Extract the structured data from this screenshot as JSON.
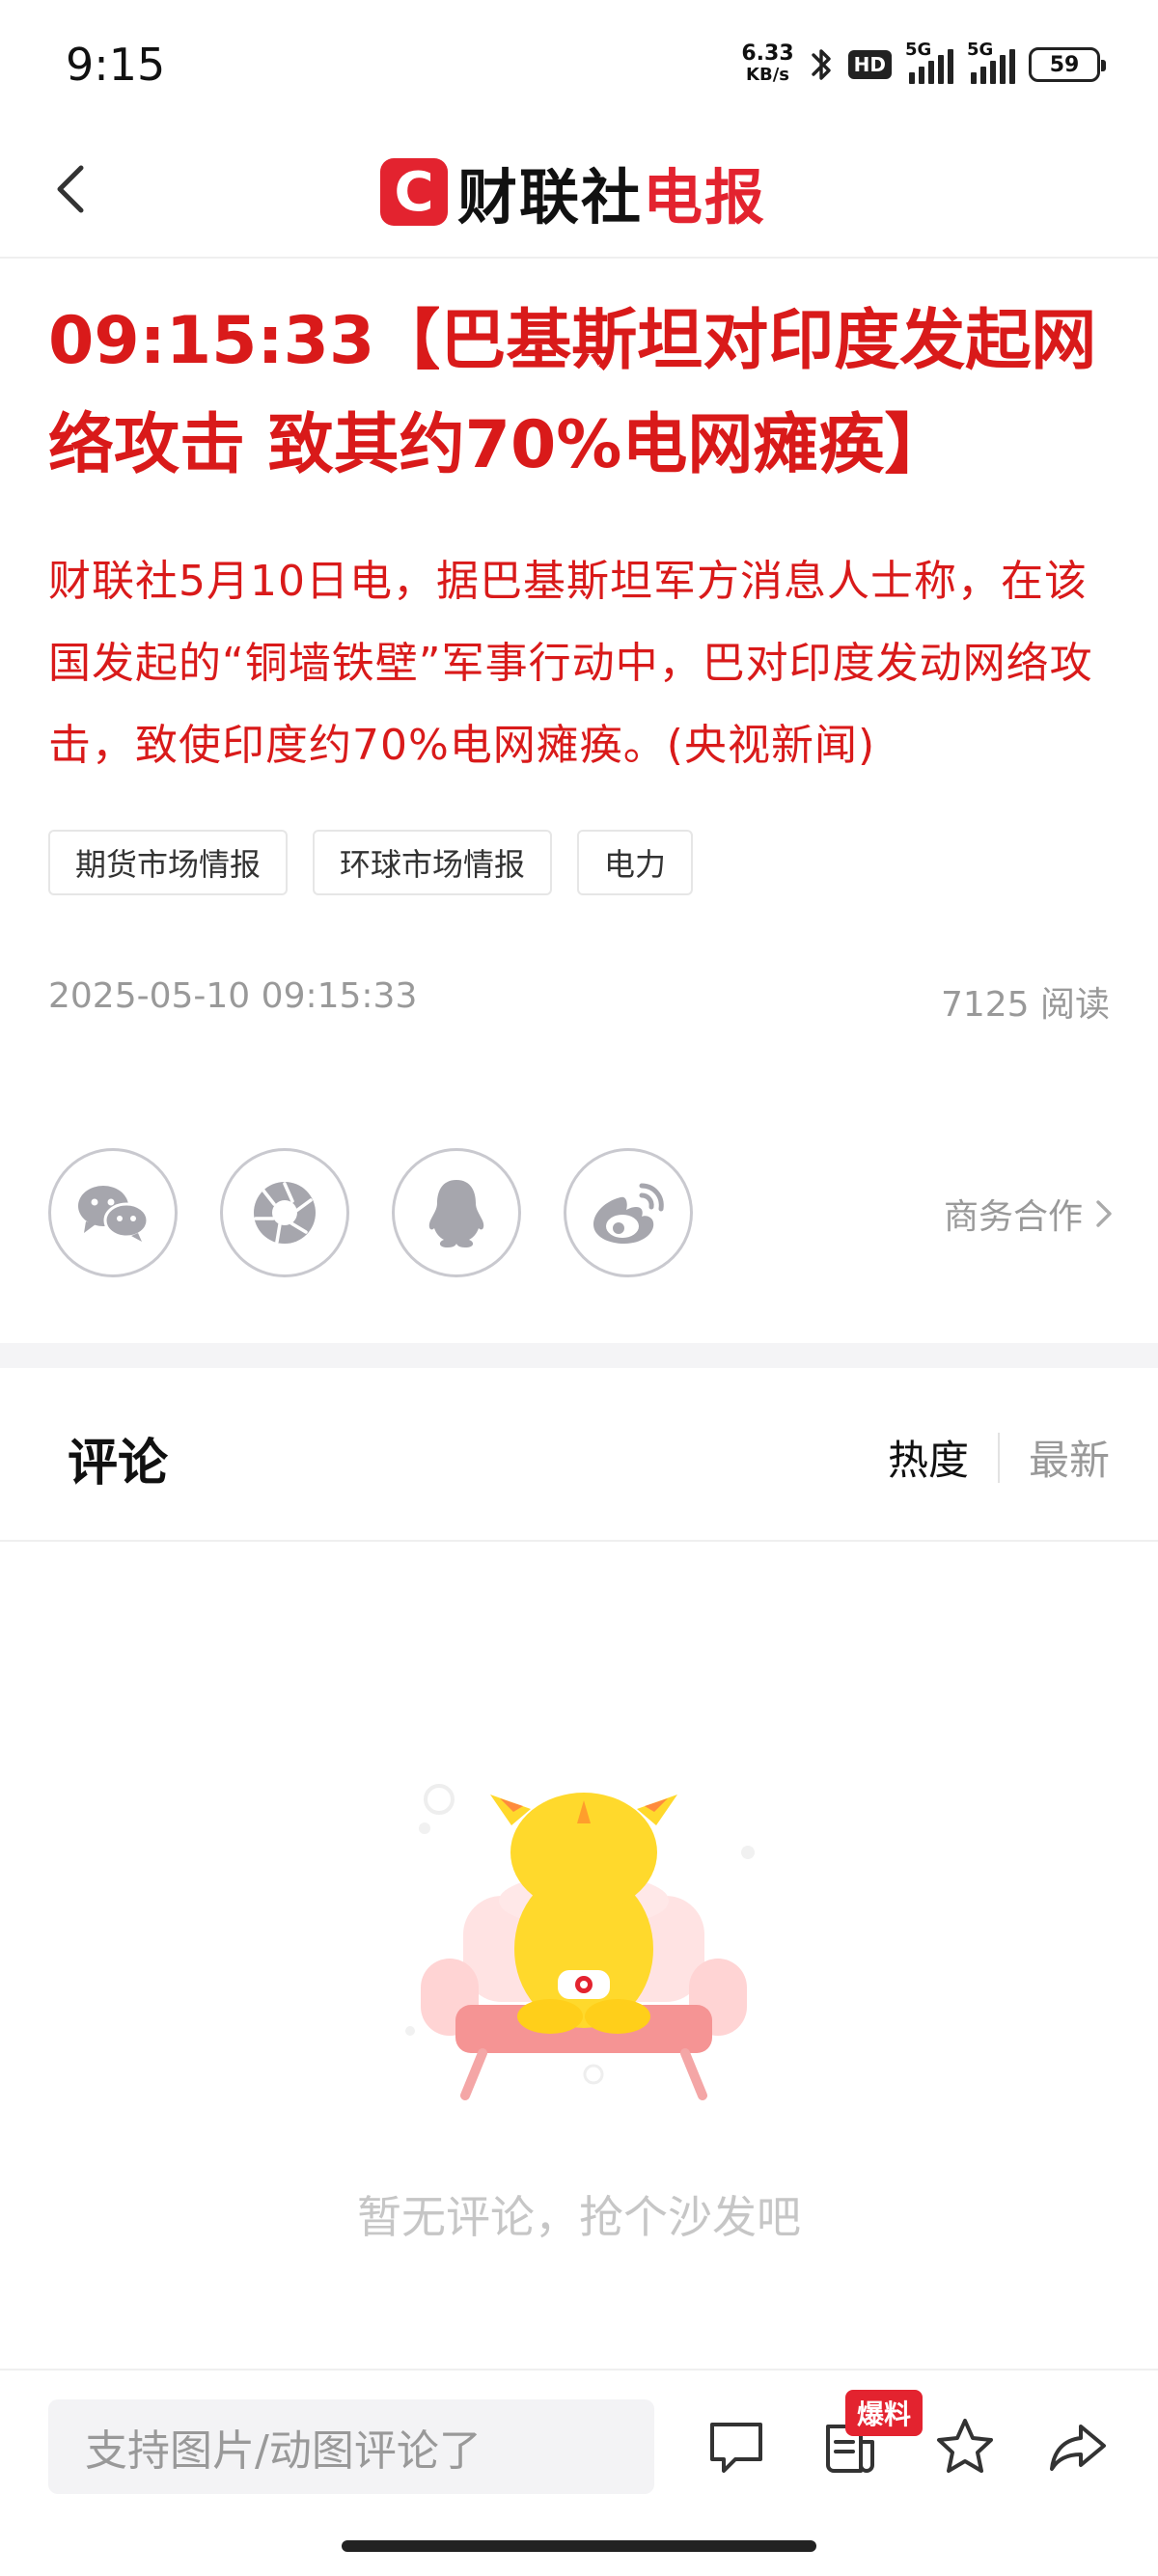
{
  "status_bar": {
    "time": "9:15",
    "net_speed_value": "6.33",
    "net_speed_unit": "KB/s",
    "hd_badge": "HD",
    "sim1_label": "5G",
    "sim2_label": "5G",
    "battery": "59"
  },
  "header": {
    "logo_letter": "C",
    "brand_black": "财联社",
    "brand_red": "电报",
    "brand_color": "#e3232f"
  },
  "article": {
    "headline": "09:15:33【巴基斯坦对印度发起网络攻击 致其约70%电网瘫痪】",
    "body": "财联社5月10日电，据巴基斯坦军方消息人士称，在该国发起的“铜墙铁壁”军事行动中，巴对印度发动网络攻击，致使印度约70%电网瘫痪。(央视新闻)",
    "tags": [
      "期货市场情报",
      "环球市场情报",
      "电力"
    ],
    "datetime": "2025-05-10 09:15:33",
    "read_count": "7125 阅读",
    "text_color": "#d91a1a"
  },
  "share": {
    "icons": [
      "wechat-icon",
      "moments-icon",
      "qq-icon",
      "weibo-icon"
    ],
    "business_link": "商务合作"
  },
  "comments": {
    "title": "评论",
    "sort_hot": "热度",
    "sort_new": "最新",
    "empty_text": "暂无评论，抢个沙发吧"
  },
  "bottom_bar": {
    "input_placeholder": "支持图片/动图评论了",
    "burst_badge": "爆料",
    "icons": [
      "comment-icon",
      "news-icon",
      "star-icon",
      "share-icon"
    ]
  }
}
